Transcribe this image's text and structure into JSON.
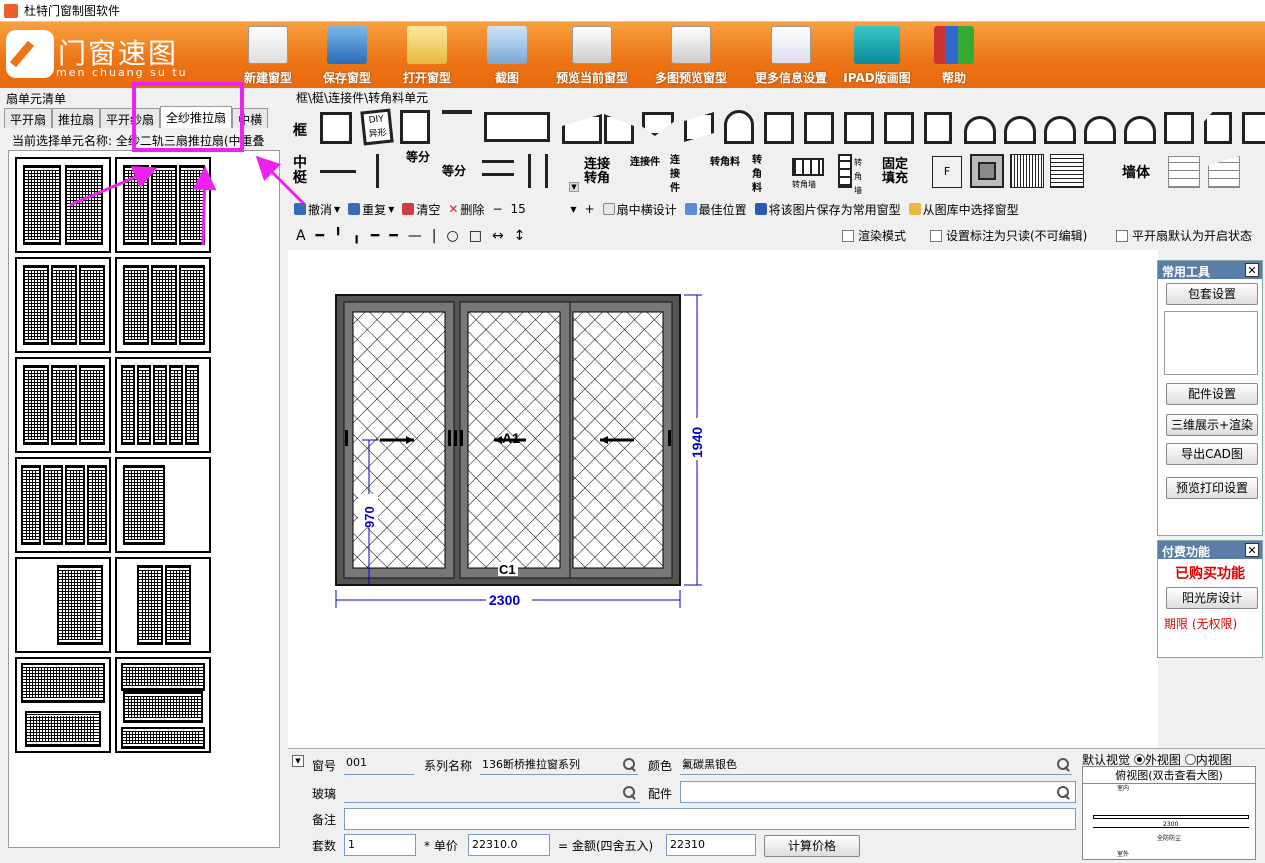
{
  "window": {
    "title": "杜特门窗制图软件"
  },
  "brand": {
    "name": "门窗速图",
    "pinyin": "men chuang su tu"
  },
  "toolbar": [
    {
      "label": "新建窗型",
      "icon": "new-document-icon"
    },
    {
      "label": "保存窗型",
      "icon": "save-icon"
    },
    {
      "label": "打开窗型",
      "icon": "open-folder-icon"
    },
    {
      "label": "截图",
      "icon": "screenshot-icon"
    },
    {
      "label": "预览当前窗型",
      "icon": "preview-icon"
    },
    {
      "label": "多图预览窗型",
      "icon": "multi-preview-icon"
    },
    {
      "label": "更多信息设置",
      "icon": "settings-icon"
    },
    {
      "label": "IPAD版画图",
      "icon": "ipad-icon"
    },
    {
      "label": "帮助",
      "icon": "help-books-icon"
    }
  ],
  "left_panel": {
    "header": "扇单元清单",
    "tabs": [
      "平开扇",
      "推拉扇",
      "平开纱扇",
      "全纱推拉扇",
      "中横"
    ],
    "active_tab": "全纱推拉扇",
    "current_label": "当前选择单元名称:",
    "current_value": "全纱二轨三扇推拉扇(中重叠"
  },
  "breadcrumb": "框\\梃\\连接件\\转角料单元",
  "row_labels": {
    "frame": "框",
    "mullion": "中梃",
    "wall": "墙体"
  },
  "mullion_tools": [
    "等分",
    "等分",
    "连接转角",
    "连接件",
    "连接件",
    "转角料",
    "转角料",
    "转角墙",
    "转角墙",
    "固定填充",
    "F"
  ],
  "diy_label": "DIY异形",
  "commands": [
    {
      "label": "撤消",
      "icon": "undo-icon"
    },
    {
      "label": "重复",
      "icon": "redo-icon"
    },
    {
      "label": "清空",
      "icon": "clear-icon"
    },
    {
      "label": "删除",
      "icon": "delete-icon"
    }
  ],
  "font_size": "15",
  "commands2": [
    {
      "label": "扇中横设计",
      "icon": "sash-design-icon"
    },
    {
      "label": "最佳位置",
      "icon": "best-position-icon"
    },
    {
      "label": "将该图片保存为常用窗型",
      "icon": "save-template-icon"
    },
    {
      "label": "从图库中选择窗型",
      "icon": "library-icon"
    }
  ],
  "checkboxes": [
    "渲染模式",
    "设置标注为只读(不可编辑)",
    "平开扇默认为开启状态"
  ],
  "drawing": {
    "width_dim": "2300",
    "height_dim": "1940",
    "handle_dim": "970",
    "sash_label": "A1",
    "frame_label": "C1"
  },
  "common_tools": {
    "title": "常用工具",
    "buttons": [
      "包套设置",
      "配件设置",
      "三维展示+渲染",
      "导出CAD图",
      "预览打印设置"
    ]
  },
  "paid": {
    "title": "付费功能",
    "status": "已购买功能",
    "button": "阳光房设计",
    "term": "期限 (无权限)"
  },
  "form": {
    "window_no_label": "窗号",
    "window_no": "001",
    "series_label": "系列名称",
    "series": "136断桥推拉窗系列",
    "color_label": "颜色",
    "color": "氟碳黑银色",
    "glass_label": "玻璃",
    "glass": "",
    "accessory_label": "配件",
    "accessory": "",
    "note_label": "备注",
    "note": "",
    "sets_label": "套数",
    "sets": "1",
    "price_label": "* 单价",
    "price": "22310.0",
    "amount_label": "= 金额(四舍五入)",
    "amount": "22310",
    "calc_button": "计算价格"
  },
  "view": {
    "default_label": "默认视觉",
    "outer": "外视图",
    "inner": "内视图",
    "selected": "外视图",
    "plan_label": "俯视图(双击查看大图)",
    "plan_in": "室内",
    "plan_out": "室外",
    "plan_dim": "2300",
    "plan_caption": "全防防尘"
  },
  "colors": {
    "banner": "#ec7414",
    "highlight": "#ee22ee",
    "dimension": "#0000cc",
    "paid_status": "#e00000"
  }
}
